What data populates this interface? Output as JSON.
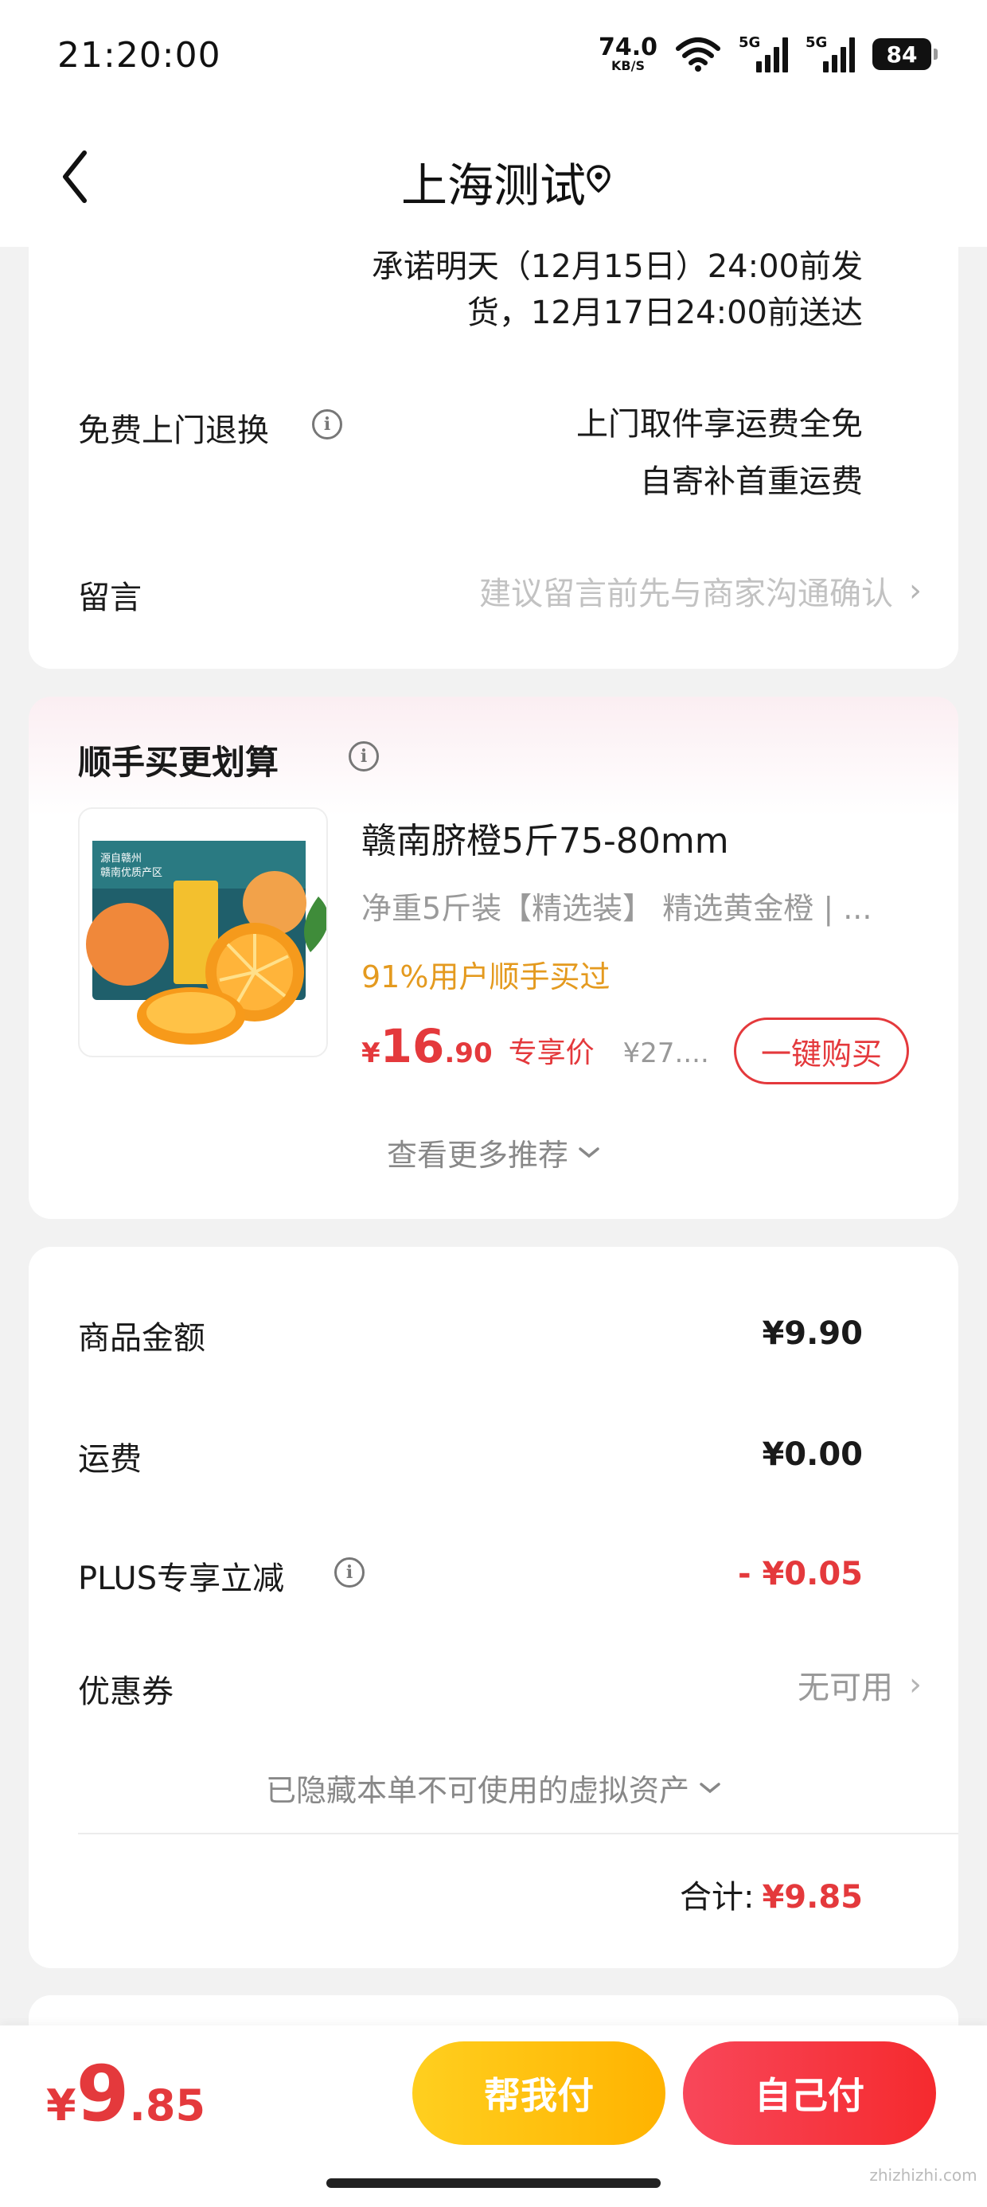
{
  "status_bar": {
    "time": "21:20:00",
    "net_speed_value": "74.0",
    "net_speed_unit": "KB/S",
    "signal1_label": "5G",
    "signal2_label": "5G",
    "battery": "84"
  },
  "header": {
    "title": "上海测试"
  },
  "delivery": {
    "promise_line1": "承诺明天（12月15日）24:00前发",
    "promise_line2": "货，12月17日24:00前送达"
  },
  "returns": {
    "label": "免费上门退换",
    "line1": "上门取件享运费全免",
    "line2": "自寄补首重运费"
  },
  "message": {
    "label": "留言",
    "placeholder": "建议留言前先与商家沟通确认"
  },
  "recommend": {
    "section_title": "顺手买更划算",
    "product_title": "赣南脐橙5斤75-80mm",
    "product_specs": "净重5斤装【精选装】  精选黄金橙 | ...",
    "social_proof": "91%用户顺手买过",
    "price_symbol": "¥",
    "price_int": "16",
    "price_dec": ".90",
    "price_tag": "专享价",
    "original_price": "¥27....",
    "buy_button": "一键购买",
    "more_link": "查看更多推荐",
    "image_box_text_1": "源自赣州",
    "image_box_text_2": "赣南优质产区",
    "image_box_brand": "赣南脐橙"
  },
  "summary": {
    "goods_label": "商品金额",
    "goods_value": "¥9.90",
    "shipping_label": "运费",
    "shipping_value": "¥0.00",
    "plus_label": "PLUS专享立减",
    "plus_value": "- ¥0.05",
    "coupon_label": "优惠券",
    "coupon_value": "无可用",
    "hidden_assets": "已隐藏本单不可使用的虚拟资产",
    "total_label": "合计:",
    "total_value": "¥9.85"
  },
  "bottom_bar": {
    "currency": "¥",
    "amount_int": "9",
    "amount_dec": ".85",
    "help_pay": "帮我付",
    "self_pay": "自己付"
  },
  "watermark": "zhizhizhi.com",
  "colors": {
    "accent_red": "#e4393c",
    "social_proof_orange": "#e49a1f",
    "help_pay_yellow": "#ffc20e",
    "self_pay_red": "#f5333f"
  }
}
